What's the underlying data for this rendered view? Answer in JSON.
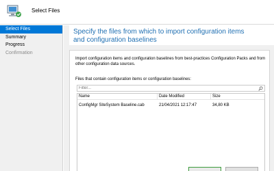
{
  "window": {
    "title": "Select Files"
  },
  "sidebar": {
    "items": [
      {
        "label": "Select Files",
        "state": "active"
      },
      {
        "label": "Summary",
        "state": "normal"
      },
      {
        "label": "Progress",
        "state": "normal"
      },
      {
        "label": "Confirmation",
        "state": "disabled"
      }
    ]
  },
  "main": {
    "heading": "Specify the files from which to import configuration items and configuration baselines",
    "description": "Import configuration items and configuration baselines from best-practices Configuration Packs and from other configuration data sources.",
    "list_label": "Files that contain configuration items or configuration baselines:",
    "filter_placeholder": "Filter...",
    "columns": [
      "Name",
      "Date Modified",
      "Size"
    ],
    "rows": [
      {
        "name": "ConfigMgr SiteSystem Baseline.cab",
        "date_modified": "21/04/2021 12:17:47",
        "size": "34,80 KB"
      }
    ]
  },
  "colors": {
    "accent": "#0078d7",
    "heading": "#1f6fb2",
    "default_button_border": "#3a9b3a"
  },
  "icons": {
    "header": "computer-install-icon",
    "filter": "search-icon"
  }
}
